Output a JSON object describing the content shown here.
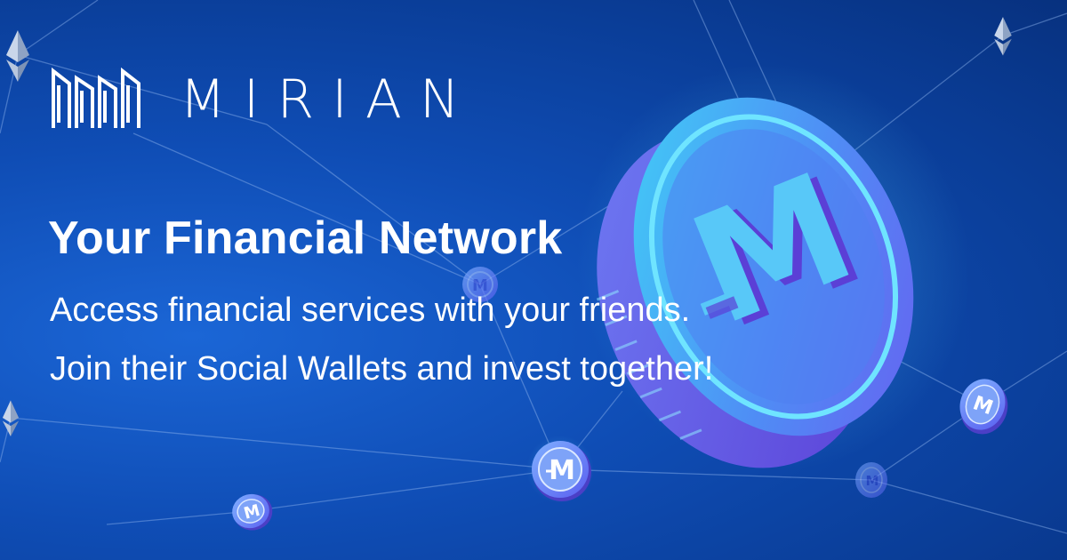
{
  "brand": {
    "name": "MIRIAN",
    "logo_icon": "mirian-logo-icon",
    "coin_letter": "M"
  },
  "hero": {
    "headline": "Your Financial Network",
    "lines": [
      "Access financial services with your friends.",
      "Join their Social Wallets and invest together!"
    ]
  },
  "colors": {
    "background_dark": "#07317f",
    "background_mid": "#0f4db5",
    "background_light": "#1b66d6",
    "coin_cyan": "#3fd0f5",
    "coin_violet": "#6a5cf0",
    "text": "#ffffff"
  },
  "decorations": {
    "network_icon": "ethereum-diamond-icon",
    "token_icon": "mirian-token-icon"
  }
}
